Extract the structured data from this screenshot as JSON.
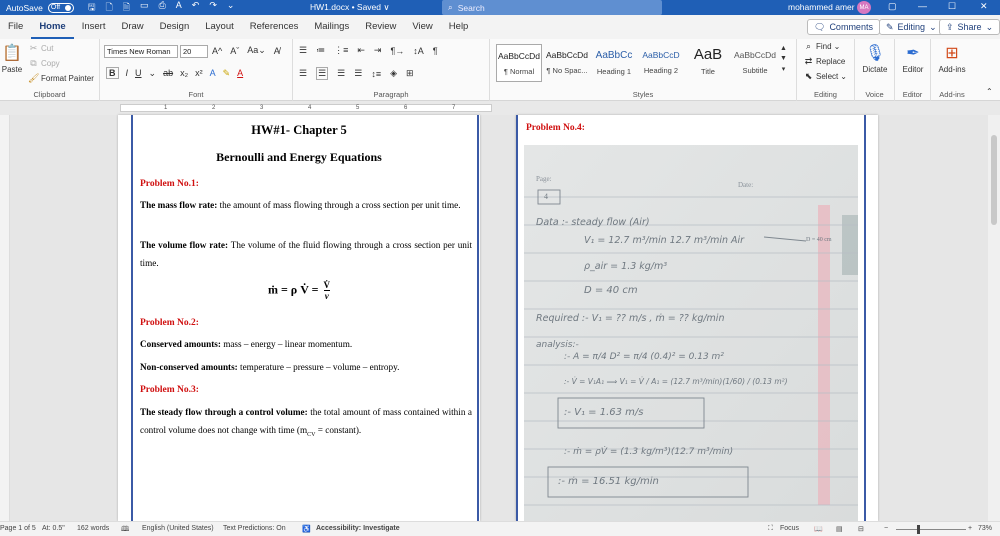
{
  "titlebar": {
    "autosave": "AutoSave",
    "toggle": "Off",
    "doc_name": "HW1.docx • Saved",
    "doc_caret": "∨",
    "search": "Search",
    "user": "mohammed amer",
    "initials": "MA"
  },
  "tabs": [
    "File",
    "Home",
    "Insert",
    "Draw",
    "Design",
    "Layout",
    "References",
    "Mailings",
    "Review",
    "View",
    "Help"
  ],
  "tab_right": {
    "comments": "Comments",
    "editing": "Editing",
    "share": "Share"
  },
  "ribbon": {
    "clipboard": {
      "paste": "Paste",
      "cut": "Cut",
      "copy": "Copy",
      "format_painter": "Format Painter",
      "label": "Clipboard"
    },
    "font": {
      "name": "Times New Roman",
      "size": "20",
      "label": "Font"
    },
    "paragraph": {
      "label": "Paragraph"
    },
    "styles": {
      "label": "Styles",
      "items": [
        {
          "sample": "AaBbCcDd",
          "name": "¶ Normal"
        },
        {
          "sample": "AaBbCcDd",
          "name": "¶ No Spac..."
        },
        {
          "sample": "AaBbCc",
          "name": "Heading 1"
        },
        {
          "sample": "AaBbCcD",
          "name": "Heading 2"
        },
        {
          "sample": "AaB",
          "name": "Title"
        },
        {
          "sample": "AaBbCcDd",
          "name": "Subtitle"
        }
      ]
    },
    "editing": {
      "find": "Find",
      "replace": "Replace",
      "select": "Select",
      "label": "Editing"
    },
    "voice": {
      "dictate": "Dictate",
      "label": "Voice"
    },
    "editor": {
      "editor": "Editor",
      "label": "Editor"
    },
    "addins": {
      "addins": "Add-ins",
      "label": "Add-ins"
    }
  },
  "ruler": [
    "1",
    "2",
    "3",
    "4",
    "5",
    "6",
    "7"
  ],
  "page1": {
    "title": "HW#1- Chapter 5",
    "subtitle": "Bernoulli and Energy Equations",
    "p1_heading": "Problem No.1:",
    "mass_term": "The mass flow rate:",
    "mass_text": " the amount of mass flowing through a cross section per unit time.",
    "vol_term": "The volume flow rate:",
    "vol_text": " The volume of the fluid flowing through a cross section per unit time.",
    "formula": "ṁ  =  ρ V̇  =",
    "formula_num": "V̇",
    "formula_den": "v",
    "p2_heading": "Problem No.2:",
    "cons_term": "Conserved amounts:",
    "cons_text": " mass – energy –  linear momentum.",
    "noncons_term": "Non-conserved amounts:",
    "noncons_text": " temperature – pressure – volume – entropy.",
    "p3_heading": "Problem No.3:",
    "steady_term": "The steady flow through a control volume:",
    "steady_text": " the total amount of mass contained within a control volume does not change with time (m",
    "steady_sub": "CV",
    "steady_end": " = constant)."
  },
  "page2": {
    "heading": "Problem No.4:",
    "photo": {
      "page_label": "Page:",
      "date_label": "Date:",
      "box_label": "4",
      "lines": [
        "Data :- steady flow (Air)",
        "V₁ = 12.7 m³/min      12.7 m³/min      Air",
        "ρ_air = 1.3 kg/m³",
        "D = 40 cm",
        "Required :- V₁ = ?? m/s  ,  ṁ = ?? kg/min",
        "analysis:-",
        ":- A = π/4 D² = π/4 (0.4)² = 0.13 m²",
        ":- V̇ = V₁A₁  ⟹  V₁ = V̇ / A₁ = (12.7 m³/min)(1/60) / (0.13 m²)",
        ":- V₁ = 1.63 m/s",
        ":- ṁ = ρV̇  = (1.3 kg/m³)(12.7 m³/min)",
        ":- ṁ = 16.51  kg/min"
      ],
      "side_label": "D = 40 cm"
    }
  },
  "status": {
    "page": "Page 1 of 5",
    "at": "At: 0.5\"",
    "words": "162 words",
    "lang": "English (United States)",
    "predictions": "Text Predictions: On",
    "accessibility": "Accessibility: Investigate",
    "focus": "Focus",
    "zoom": "73%"
  },
  "colors": {
    "titlebar": "#1f5fb6",
    "heading_red": "#d01010",
    "margin_line": "#3b5aa6"
  }
}
